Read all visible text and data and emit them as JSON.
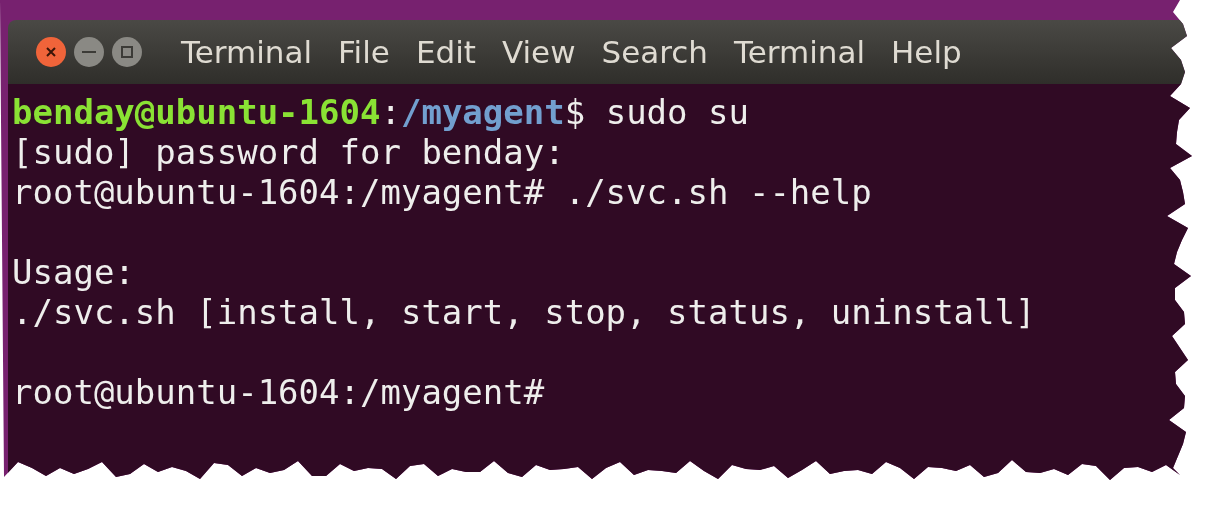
{
  "window": {
    "title": "Terminal"
  },
  "menu": [
    "File",
    "Edit",
    "View",
    "Search",
    "Terminal",
    "Help"
  ],
  "terminal": {
    "lines": [
      {
        "kind": "text",
        "segments": [
          {
            "kind": "user",
            "text": "benday@ubuntu-1604"
          },
          {
            "kind": "plain",
            "text": ":"
          },
          {
            "kind": "path",
            "text": "/myagent"
          },
          {
            "kind": "plain",
            "text": "$ sudo su"
          }
        ]
      },
      {
        "kind": "text",
        "segments": [
          {
            "kind": "plain",
            "text": "[sudo] password for benday:"
          }
        ]
      },
      {
        "kind": "text",
        "segments": [
          {
            "kind": "plain",
            "text": "root@ubuntu-1604:/myagent# ./svc.sh --help"
          }
        ]
      },
      {
        "kind": "blank"
      },
      {
        "kind": "text",
        "segments": [
          {
            "kind": "plain",
            "text": "Usage:"
          }
        ]
      },
      {
        "kind": "text",
        "segments": [
          {
            "kind": "plain",
            "text": "./svc.sh [install, start, stop, status, uninstall]"
          }
        ]
      },
      {
        "kind": "blank"
      },
      {
        "kind": "text",
        "segments": [
          {
            "kind": "plain",
            "text": "root@ubuntu-1604:/myagent#"
          }
        ]
      }
    ]
  }
}
